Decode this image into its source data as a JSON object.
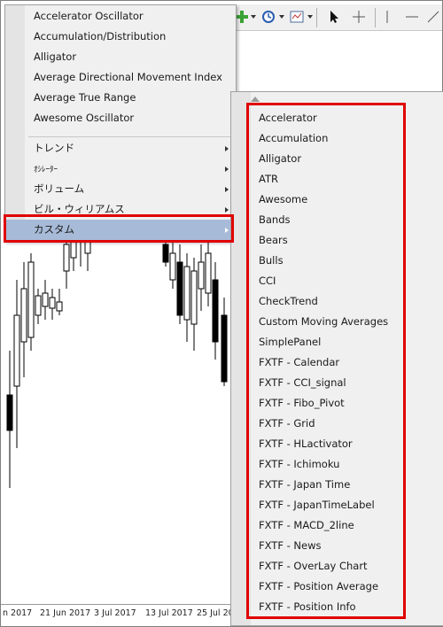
{
  "menu": {
    "items": [
      {
        "label": "Accelerator Oscillator"
      },
      {
        "label": "Accumulation/Distribution"
      },
      {
        "label": "Alligator"
      },
      {
        "label": "Average Directional Movement Index"
      },
      {
        "label": "Average True Range"
      },
      {
        "label": "Awesome Oscillator"
      }
    ],
    "submenus": [
      {
        "label": "トレンド"
      },
      {
        "label": "ｵｼﾚｰﾀｰ"
      },
      {
        "label": "ボリューム"
      },
      {
        "label": "ビル・ウィリアムス"
      },
      {
        "label": "カスタム"
      }
    ]
  },
  "submenu": {
    "items": [
      "Accelerator",
      "Accumulation",
      "Alligator",
      "ATR",
      "Awesome",
      "Bands",
      "Bears",
      "Bulls",
      "CCI",
      "CheckTrend",
      "Custom Moving Averages",
      "SimplePanel",
      "FXTF - Calendar",
      "FXTF - CCI_signal",
      "FXTF - Fibo_Pivot",
      "FXTF - Grid",
      "FXTF - HLactivator",
      "FXTF - Ichimoku",
      "FXTF - Japan Time",
      "FXTF - JapanTimeLabel",
      "FXTF - MACD_2line",
      "FXTF - News",
      "FXTF - OverLay Chart",
      "FXTF - Position Average",
      "FXTF - Position Info"
    ]
  },
  "chart": {
    "x_labels": [
      "n 2017",
      "21 Jun 2017",
      "3 Jul 2017",
      "13 Jul 2017",
      "25 Jul 201"
    ]
  },
  "colors": {
    "highlight": "#e00000",
    "selected": "#a7bad7"
  }
}
